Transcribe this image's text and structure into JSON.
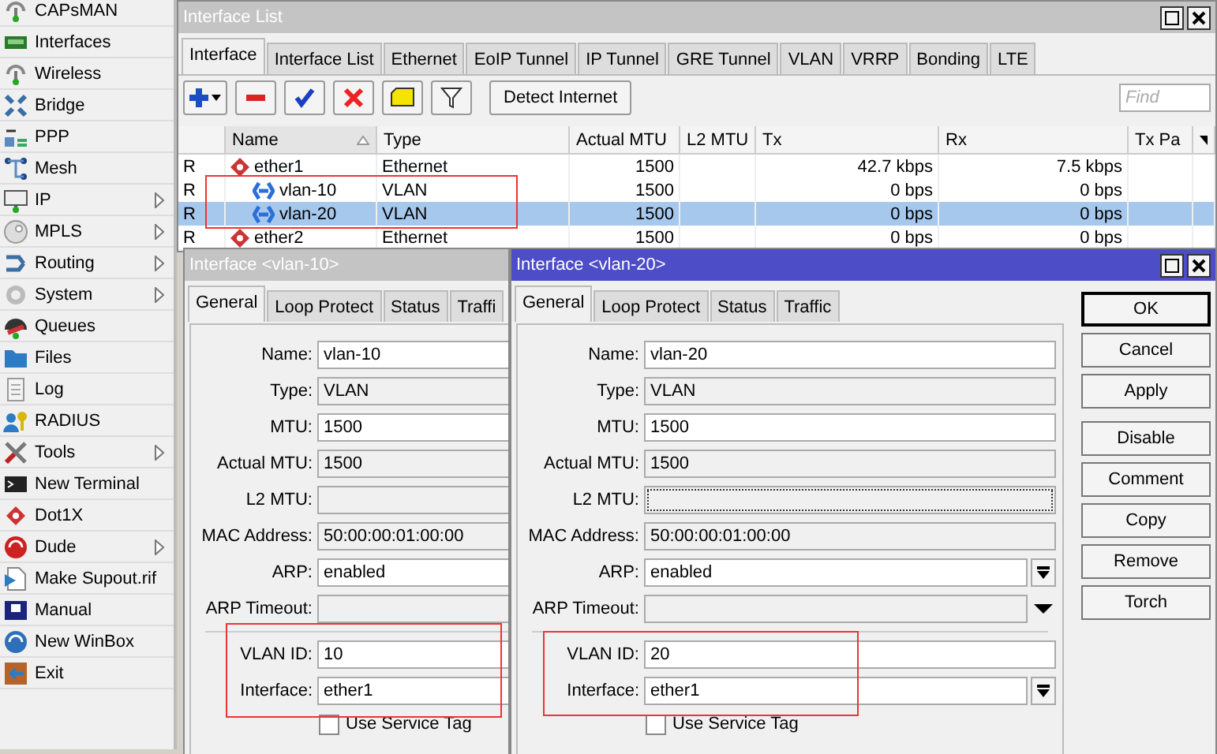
{
  "sidebar": {
    "items": [
      {
        "label": "CAPsMAN",
        "submenu": false
      },
      {
        "label": "Interfaces",
        "submenu": false
      },
      {
        "label": "Wireless",
        "submenu": false
      },
      {
        "label": "Bridge",
        "submenu": false
      },
      {
        "label": "PPP",
        "submenu": false
      },
      {
        "label": "Mesh",
        "submenu": false
      },
      {
        "label": "IP",
        "submenu": true
      },
      {
        "label": "MPLS",
        "submenu": true
      },
      {
        "label": "Routing",
        "submenu": true
      },
      {
        "label": "System",
        "submenu": true
      },
      {
        "label": "Queues",
        "submenu": false
      },
      {
        "label": "Files",
        "submenu": false
      },
      {
        "label": "Log",
        "submenu": false
      },
      {
        "label": "RADIUS",
        "submenu": false
      },
      {
        "label": "Tools",
        "submenu": true
      },
      {
        "label": "New Terminal",
        "submenu": false
      },
      {
        "label": "Dot1X",
        "submenu": false
      },
      {
        "label": "Dude",
        "submenu": true
      },
      {
        "label": "Make Supout.rif",
        "submenu": false
      },
      {
        "label": "Manual",
        "submenu": false
      },
      {
        "label": "New WinBox",
        "submenu": false
      },
      {
        "label": "Exit",
        "submenu": false
      }
    ]
  },
  "interface_list": {
    "title": "Interface List",
    "tabs": [
      {
        "label": "Interface",
        "selected": true
      },
      {
        "label": "Interface List",
        "selected": false
      },
      {
        "label": "Ethernet",
        "selected": false
      },
      {
        "label": "EoIP Tunnel",
        "selected": false
      },
      {
        "label": "IP Tunnel",
        "selected": false
      },
      {
        "label": "GRE Tunnel",
        "selected": false
      },
      {
        "label": "VLAN",
        "selected": false
      },
      {
        "label": "VRRP",
        "selected": false
      },
      {
        "label": "Bonding",
        "selected": false
      },
      {
        "label": "LTE",
        "selected": false
      }
    ],
    "toolbar": {
      "detect_button": "Detect Internet",
      "find": {
        "placeholder": "Find"
      }
    },
    "table": {
      "columns": [
        {
          "label": "Name",
          "sorted": true
        },
        {
          "label": "Type",
          "sorted": false
        },
        {
          "label": "Actual MTU",
          "sorted": false
        },
        {
          "label": "L2 MTU",
          "sorted": false
        },
        {
          "label": "Tx",
          "sorted": false
        },
        {
          "label": "Rx",
          "sorted": false
        },
        {
          "label": "Tx Pa",
          "sorted": false
        }
      ],
      "rows": [
        {
          "flag": "R",
          "name": "ether1",
          "type": "Ethernet",
          "kind": "ethernet",
          "actual_mtu": "1500",
          "tx": "42.7 kbps",
          "rx": "7.5 kbps",
          "selected": false,
          "children": [
            {
              "flag": "R",
              "name": "vlan-10",
              "type": "VLAN",
              "kind": "vlan",
              "actual_mtu": "1500",
              "tx": "0 bps",
              "rx": "0 bps",
              "selected": false
            },
            {
              "flag": "R",
              "name": "vlan-20",
              "type": "VLAN",
              "kind": "vlan",
              "actual_mtu": "1500",
              "tx": "0 bps",
              "rx": "0 bps",
              "selected": true
            }
          ]
        },
        {
          "flag": "R",
          "name": "ether2",
          "type": "Ethernet",
          "kind": "ethernet",
          "actual_mtu": "1500",
          "tx": "0 bps",
          "rx": "0 bps",
          "selected": false
        }
      ]
    }
  },
  "dialogs": [
    {
      "title": "Interface <vlan-10>",
      "active": false,
      "tabs": [
        {
          "label": "General",
          "selected": true
        },
        {
          "label": "Loop Protect",
          "selected": false
        },
        {
          "label": "Status",
          "selected": false
        },
        {
          "label": "Traffi",
          "selected": false
        }
      ],
      "sections": [
        [
          {
            "label": "Name:",
            "value": "vlan-10",
            "kind": "input",
            "focused": false
          },
          {
            "label": "Type:",
            "value": "VLAN",
            "kind": "static",
            "focused": false
          },
          {
            "label": "MTU:",
            "value": "1500",
            "kind": "input",
            "focused": false
          },
          {
            "label": "Actual MTU:",
            "value": "1500",
            "kind": "static",
            "focused": false
          },
          {
            "label": "L2 MTU:",
            "kind": "static",
            "focused": false
          },
          {
            "label": "MAC Address:",
            "value": "50:00:00:01:00:00",
            "kind": "static",
            "focused": false
          },
          {
            "label": "ARP:",
            "value": "enabled",
            "kind": "input",
            "focused": false
          },
          {
            "label": "ARP Timeout:",
            "kind": "static",
            "focused": false
          }
        ],
        [
          {
            "label": "VLAN ID:",
            "value": "10",
            "kind": "input",
            "focused": false
          },
          {
            "label": "Interface:",
            "value": "ether1",
            "kind": "input",
            "focused": false
          }
        ]
      ],
      "checkbox": {
        "label": "Use Service Tag",
        "checked": false
      }
    },
    {
      "title": "Interface <vlan-20>",
      "active": true,
      "tabs": [
        {
          "label": "General",
          "selected": true
        },
        {
          "label": "Loop Protect",
          "selected": false
        },
        {
          "label": "Status",
          "selected": false
        },
        {
          "label": "Traffic",
          "selected": false
        }
      ],
      "sections": [
        [
          {
            "label": "Name:",
            "value": "vlan-20",
            "kind": "input",
            "focused": false
          },
          {
            "label": "Type:",
            "value": "VLAN",
            "kind": "static",
            "focused": false
          },
          {
            "label": "MTU:",
            "value": "1500",
            "kind": "input",
            "focused": false
          },
          {
            "label": "Actual MTU:",
            "value": "1500",
            "kind": "static",
            "focused": false
          },
          {
            "label": "L2 MTU:",
            "kind": "static",
            "focused": true
          },
          {
            "label": "MAC Address:",
            "value": "50:00:00:01:00:00",
            "kind": "static",
            "focused": false
          },
          {
            "label": "ARP:",
            "value": "enabled",
            "kind": "select",
            "focused": false
          },
          {
            "label": "ARP Timeout:",
            "kind": "static-select",
            "focused": false
          }
        ],
        [
          {
            "label": "VLAN ID:",
            "value": "20",
            "kind": "input",
            "focused": false
          },
          {
            "label": "Interface:",
            "value": "ether1",
            "kind": "select",
            "focused": false
          }
        ]
      ],
      "checkbox": {
        "label": "Use Service Tag",
        "checked": false
      },
      "buttons": [
        [
          {
            "label": "OK",
            "default": true
          },
          {
            "label": "Cancel",
            "default": false
          },
          {
            "label": "Apply",
            "default": false
          }
        ],
        [
          {
            "label": "Disable",
            "default": false
          },
          {
            "label": "Comment",
            "default": false
          },
          {
            "label": "Copy",
            "default": false
          },
          {
            "label": "Remove",
            "default": false
          },
          {
            "label": "Torch",
            "default": false
          }
        ]
      ]
    }
  ]
}
